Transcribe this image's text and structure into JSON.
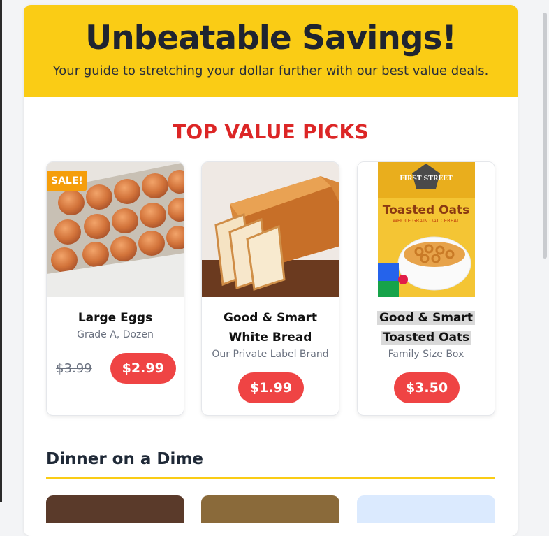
{
  "hero": {
    "title": "Unbeatable Savings!",
    "subtitle": "Your guide to stretching your dollar further with our best value deals."
  },
  "top_picks": {
    "title": "TOP VALUE PICKS",
    "products": [
      {
        "name_line1": "Large Eggs",
        "name_line2": "",
        "description": "Grade A, Dozen",
        "old_price": "$3.99",
        "price": "$2.99",
        "badge": "SALE!",
        "image_icon": "eggs-carton-image"
      },
      {
        "name_line1": "Good & Smart",
        "name_line2": "White Bread",
        "description": "Our Private Label Brand",
        "price": "$1.99",
        "image_icon": "bread-image"
      },
      {
        "name_line1": "Good & Smart",
        "name_line2": "Toasted Oats",
        "description": "Family Size Box",
        "price": "$3.50",
        "image_icon": "cereal-box-image",
        "box_brand": "FIRST STREET",
        "box_title": "Toasted Oats",
        "box_subtitle": "WHOLE GRAIN OAT CEREAL"
      }
    ]
  },
  "dinner": {
    "title": "Dinner on a Dime"
  },
  "colors": {
    "hero_bg": "#facc15",
    "accent_red": "#dc2626",
    "price_pill": "#ef4444",
    "sale_badge": "#f59e0b"
  }
}
